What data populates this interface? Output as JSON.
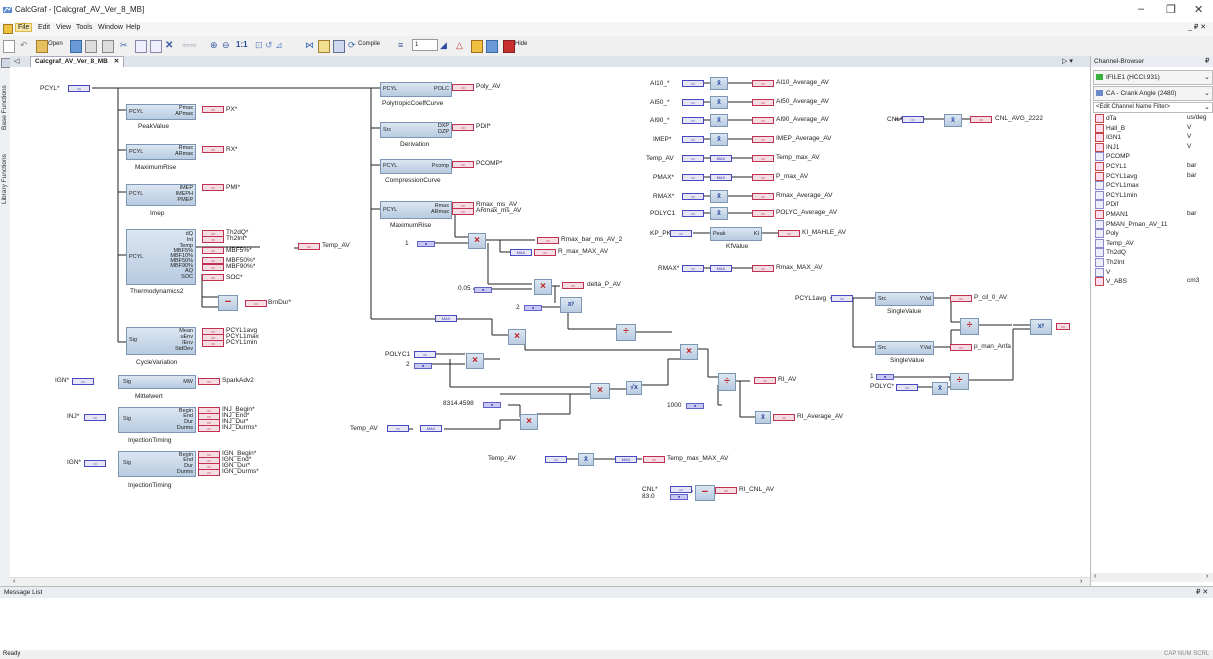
{
  "window": {
    "title": "CalcGraf - [Calcgraf_AV_Ver_8_MB]",
    "minimize": "–",
    "restore": "❐",
    "close": "✕",
    "doc_controls": "_ ₽ ✕"
  },
  "menu": [
    "File",
    "Edit",
    "View",
    "Tools",
    "Window",
    "Help"
  ],
  "toolbar": {
    "open": "Open",
    "compile": "Compile",
    "step_value": "1",
    "hide": "Hide"
  },
  "left_tabs": [
    "Base Functions",
    "Library Functions"
  ],
  "doc_tab": "Calcgraf_AV_Ver_8_MB",
  "canvas_nav": "▷ ▾",
  "channel_browser": {
    "header": "Channel-Browser",
    "pin": "₽",
    "file": "IFILE1 (HCCI.931)",
    "axis": "CA - Crank Angle (2480)",
    "filter_placeholder": "<Edit Channel Name Filter>",
    "channels": [
      {
        "name": "dTa",
        "unit": "us/deg"
      },
      {
        "name": "Hall_B",
        "unit": "V"
      },
      {
        "name": "IGN1",
        "unit": "V"
      },
      {
        "name": "INJ1",
        "unit": "V"
      },
      {
        "name": "PCOMP",
        "unit": ""
      },
      {
        "name": "PCYL1",
        "unit": "bar"
      },
      {
        "name": "PCYL1avg",
        "unit": "bar"
      },
      {
        "name": "PCYL1max",
        "unit": ""
      },
      {
        "name": "PCYL1min",
        "unit": ""
      },
      {
        "name": "PDif",
        "unit": ""
      },
      {
        "name": "PMAN1",
        "unit": "bar"
      },
      {
        "name": "PMAN_Pman_AV_11",
        "unit": ""
      },
      {
        "name": "Poly",
        "unit": ""
      },
      {
        "name": "Temp_AV",
        "unit": ""
      },
      {
        "name": "Th2dQ",
        "unit": ""
      },
      {
        "name": "Th2Int",
        "unit": ""
      },
      {
        "name": "V",
        "unit": ""
      },
      {
        "name": "V_ABS",
        "unit": "cm3"
      }
    ]
  },
  "message_list": {
    "header": "Message List",
    "pin": "₽ ✕"
  },
  "status": {
    "left": "Ready",
    "right": "CAP NUM SCRL"
  },
  "diagram": {
    "pcyl_in": "PCYL*",
    "blocks": {
      "peak": {
        "name": "PeakValue",
        "in": "PCYL",
        "outs": [
          "Pmax",
          "APmax"
        ],
        "out_label": "PX*"
      },
      "maxrise": {
        "name": "MaximumRise",
        "in": "PCYL",
        "outs": [
          "Rmax",
          "ARmax"
        ],
        "out_label": "RX*"
      },
      "imep": {
        "name": "Imep",
        "in": "PCYL",
        "outs": [
          "IMEP",
          "IMEPH",
          "PMEP"
        ],
        "out_label": "PMI*"
      },
      "thermo": {
        "name": "Thermodynamics2",
        "in": "PCYL",
        "outs": [
          "dQ",
          "Int",
          "Temp",
          "MBF5%",
          "MBF10%",
          "MBF50%",
          "MBF90%",
          "AQ",
          "SOC"
        ],
        "out_labels": [
          "Th2dQ*",
          "Th2Int*",
          "MBF5%*",
          "MBF50%*",
          "MBF90%*",
          "SOC*"
        ],
        "temp_out": "Temp_AV",
        "brn_out": "BrnDur*"
      },
      "cyclevar": {
        "name": "CycleVariation",
        "in": "Sig",
        "outs": [
          "Mean",
          "uEnv",
          "lEnv",
          "StdDev"
        ],
        "out_labels": [
          "PCYL1avg",
          "PCYL1max",
          "PCYL1min"
        ]
      },
      "mittel": {
        "name": "Mittelwert",
        "in_label": "IGN*",
        "in": "Sig",
        "outs": [
          "MW"
        ],
        "out_label": "SparkAdv2"
      },
      "inj1": {
        "name": "InjectionTiming",
        "in_label": "INJ*",
        "in": "Sig",
        "outs": [
          "Begin",
          "End",
          "Dur",
          "Durms"
        ],
        "out_labels": [
          "INJ_Begin*",
          "INJ_End*",
          "INJ_Dur*",
          "INJ_Durms*"
        ]
      },
      "inj2": {
        "name": "InjectionTiming",
        "in_label": "IGN*",
        "in": "Sig",
        "outs": [
          "Begin",
          "End",
          "Dur",
          "Durms"
        ],
        "out_labels": [
          "IGN_Begin*",
          "IGN_End*",
          "IGN_Dur*",
          "IGN_Durms*"
        ]
      },
      "poly": {
        "name": "PolytropicCoeffCurve",
        "in": "PCYL",
        "outs": [
          "POLC"
        ],
        "out_label": "Poly_AV"
      },
      "deriv": {
        "name": "Derivation",
        "in": "Src",
        "outs": [
          "DXP",
          "DZP"
        ],
        "out_label": "PDif*"
      },
      "comp": {
        "name": "CompressionCurve",
        "in": "PCYL",
        "outs": [
          "Pcomp"
        ],
        "out_label": "PCOMP*"
      },
      "maxrise2": {
        "name": "MaximumRise",
        "in": "PCYL",
        "outs": [
          "Rmax",
          "ARmax"
        ],
        "out_labels": [
          "Rmax_ms_AV",
          "ARmax_ms_AV"
        ]
      },
      "kfvalue": {
        "name": "KfValue",
        "in_label": "KP_PK*",
        "in": "Peak",
        "outs": [
          "KI"
        ],
        "out_label": "KI_MAHLE_AV"
      },
      "single1": {
        "name": "SingleValue",
        "in_label": "PCYL1avg",
        "in": "Src",
        "outs": [
          "YVal"
        ],
        "out_label": "P_cil_0_AV"
      },
      "single2": {
        "name": "SingleValue",
        "in": "Src",
        "outs": [
          "YVal"
        ],
        "out_label": "p_man_Anfa"
      }
    },
    "avg_rows": [
      {
        "in": "AI10_*",
        "out": "AI10_Average_AV"
      },
      {
        "in": "AI50_*",
        "out": "AI50_Average_AV"
      },
      {
        "in": "AI90_*",
        "out": "AI90_Average_AV"
      },
      {
        "in": "IMEP*",
        "out": "IMEP_Average_AV"
      },
      {
        "in": "Temp_AV",
        "out": "Temp_max_AV"
      },
      {
        "in": "PMAX*",
        "out": "P_max_AV"
      },
      {
        "in": "RMAX*",
        "out": "Rmax_Average_AV"
      }
    ],
    "cnl_avg": {
      "in": "CNL*",
      "out": "CNL_AVG_2222"
    },
    "polyc1": {
      "in": "POLYC1",
      "out": "POLYC_Average_AV"
    },
    "rmax_max": {
      "in": "RMAX*",
      "out": "Rmax_MAX_AV"
    },
    "rmax_bar": {
      "const": "1",
      "out1": "Rmax_bar_ms_AV_2",
      "out2": "R_max_MAX_AV"
    },
    "delta_p": {
      "const1": "0.05",
      "const2": "2",
      "out": "delta_P_AV"
    },
    "ri": {
      "in_polyc": "POLYC1",
      "const2": "2",
      "const_r": "8314.4598",
      "const_1000": "1000",
      "temp_in": "Temp_AV",
      "out": "RI_AV",
      "out_avg": "RI_Average_AV"
    },
    "temp_max": {
      "in": "Temp_AV",
      "out": "Temp_max_MAX_AV"
    },
    "ri_cnl": {
      "in": "CNL*",
      "const": "83.0",
      "out": "RI_CNL_AV"
    },
    "pman": {
      "const": "1",
      "in": "POLYC*"
    }
  }
}
